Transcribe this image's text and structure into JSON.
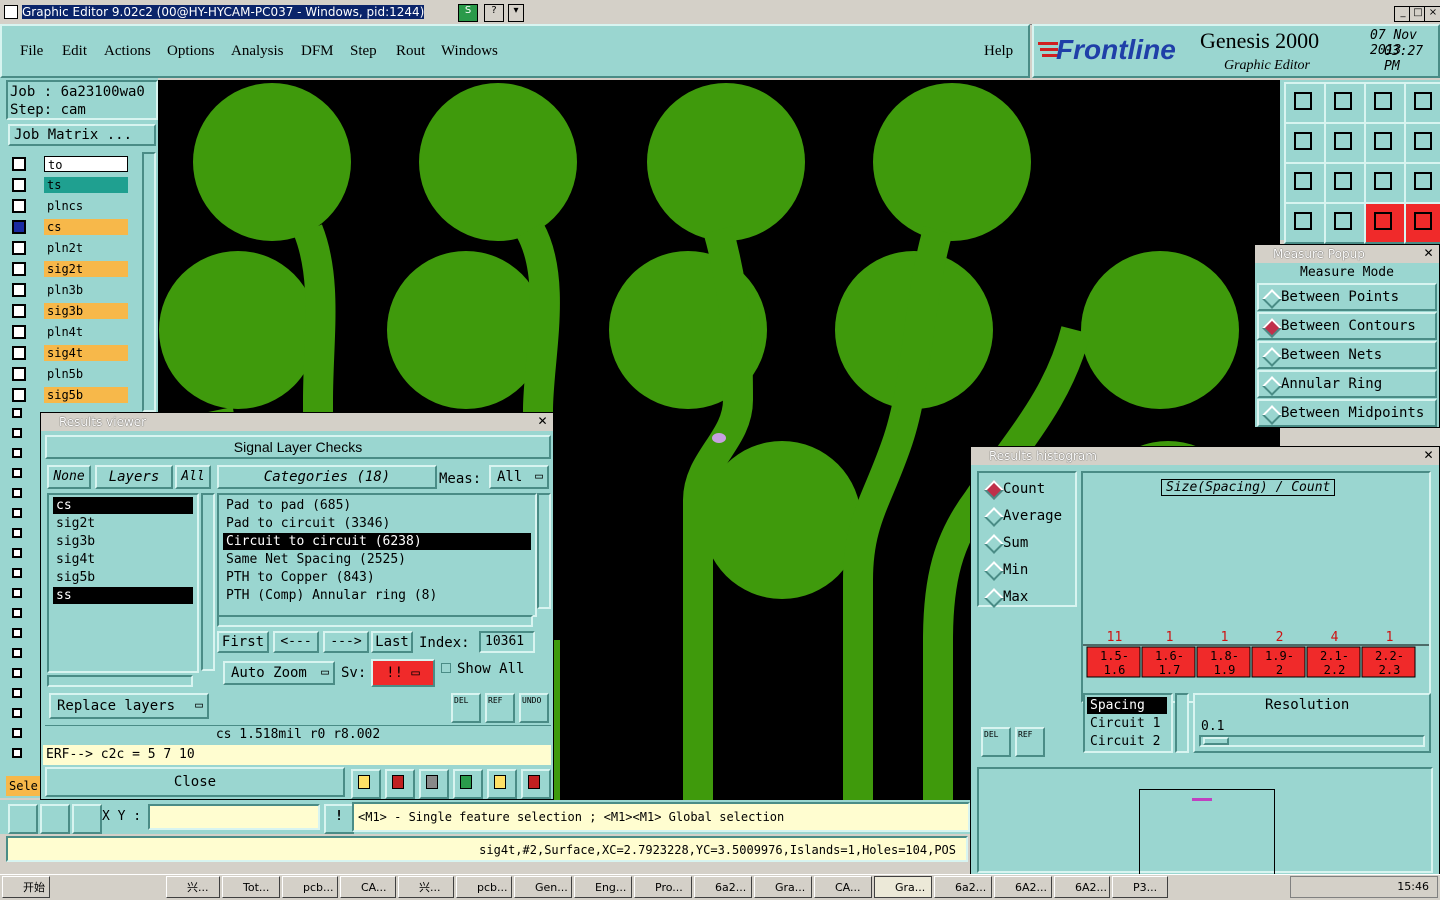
{
  "window": {
    "title": "Graphic Editor 9.02c2 (00@HY-HYCAM-PC037 - Windows, pid:1244)"
  },
  "menu": {
    "items": [
      "File",
      "Edit",
      "Actions",
      "Options",
      "Analysis",
      "DFM",
      "Step",
      "Rout",
      "Windows"
    ],
    "help": "Help"
  },
  "brand": {
    "logo": "Frontline",
    "product": "Genesis 2000",
    "subtitle": "Graphic Editor",
    "date": "07 Nov 2013",
    "time": "03:27 PM"
  },
  "job": {
    "job_line": "Job : 6a23100wa0",
    "step_line": "Step: cam",
    "matrix_button": "Job Matrix ..."
  },
  "layers": [
    {
      "name": "to",
      "color": "#ffffff",
      "active": false
    },
    {
      "name": "ts",
      "color": "#1fa090",
      "active": false
    },
    {
      "name": "plncs",
      "color": "#9ad6d0",
      "active": false
    },
    {
      "name": "cs",
      "color": "#f7b84a",
      "active": true
    },
    {
      "name": "pln2t",
      "color": "#9ad6d0",
      "active": false
    },
    {
      "name": "sig2t",
      "color": "#f7b84a",
      "active": false
    },
    {
      "name": "pln3b",
      "color": "#9ad6d0",
      "active": false
    },
    {
      "name": "sig3b",
      "color": "#f7b84a",
      "active": false
    },
    {
      "name": "pln4t",
      "color": "#9ad6d0",
      "active": false
    },
    {
      "name": "sig4t",
      "color": "#f7b84a",
      "active": false
    },
    {
      "name": "pln5b",
      "color": "#9ad6d0",
      "active": false
    },
    {
      "name": "sig5b",
      "color": "#f7b84a",
      "active": false
    }
  ],
  "sele_label": "Sele",
  "results_viewer": {
    "title": "Results viewer",
    "header": "Signal Layer Checks",
    "none_btn": "None",
    "layers_btn": "Layers",
    "all_btn": "All",
    "categories_btn": "Categories (18)",
    "meas_label": "Meas:",
    "meas_value": "All",
    "layer_list": [
      "cs",
      "sig2t",
      "sig3b",
      "sig4t",
      "sig5b",
      "ss"
    ],
    "categories": [
      "Pad to pad (685)",
      "Pad to circuit (3346)",
      "Circuit to circuit (6238)",
      "Same Net Spacing (2525)",
      "PTH to Copper (843)",
      "PTH (Comp) Annular ring (8)"
    ],
    "nav": {
      "first": "First",
      "prev": "<---",
      "next": "--->",
      "last": "Last",
      "index_label": "Index:",
      "index_value": "10361"
    },
    "auto_zoom": "Auto Zoom",
    "sv_label": "Sv:",
    "sv_value": "!!",
    "show_all": "Show All",
    "replace_layers": "Replace layers",
    "small_btns": [
      "DEL",
      "REF",
      "UNDO"
    ],
    "status": "cs 1.518mil   r0   r8.002",
    "erf": "ERF--> c2c = 5 7 10",
    "close": "Close"
  },
  "measure_popup": {
    "title": "Measure Popup",
    "header": "Measure Mode",
    "options": [
      {
        "label": "Between Points",
        "selected": false
      },
      {
        "label": "Between Contours",
        "selected": true
      },
      {
        "label": "Between Nets",
        "selected": false
      },
      {
        "label": "Annular Ring",
        "selected": false
      },
      {
        "label": "Between Midpoints",
        "selected": false
      }
    ]
  },
  "histogram": {
    "title": "Results histogram",
    "modes": [
      {
        "label": "Count",
        "selected": true
      },
      {
        "label": "Average",
        "selected": false
      },
      {
        "label": "Sum",
        "selected": false
      },
      {
        "label": "Min",
        "selected": false
      },
      {
        "label": "Max",
        "selected": false
      }
    ],
    "chart_title": "Size(Spacing) / Count",
    "bins": [
      {
        "count": "11",
        "top": "1.5-",
        "bottom": "1.6"
      },
      {
        "count": "1",
        "top": "1.6-",
        "bottom": "1.7"
      },
      {
        "count": "1",
        "top": "1.8-",
        "bottom": "1.9"
      },
      {
        "count": "2",
        "top": "1.9-",
        "bottom": "2"
      },
      {
        "count": "4",
        "top": "2.1-",
        "bottom": "2.2"
      },
      {
        "count": "1",
        "top": "2.2-",
        "bottom": "2.3"
      }
    ],
    "list": [
      "Spacing",
      "Circuit 1",
      "Circuit 2"
    ],
    "resolution_label": "Resolution",
    "resolution_value": "0.1",
    "small_btns": [
      "DEL",
      "REF"
    ]
  },
  "bottom": {
    "xy_label": "X Y :",
    "xy_value": "",
    "hint": "<M1> - Single feature selection ; <M1><M1> Global selection",
    "feature_info": "sig4t,#2,Surface,XC=2.7923228,YC=3.5009976,Islands=1,Holes=104,POS"
  },
  "taskbar": {
    "start": "开始",
    "tasks": [
      "兴...",
      "Tot...",
      "pcb...",
      "CA...",
      "兴...",
      "pcb...",
      "Gen...",
      "Eng...",
      "Pro...",
      "6a2...",
      "Gra...",
      "CA...",
      "Gra...",
      "6a2...",
      "6A2...",
      "6A2...",
      "P3..."
    ],
    "clock": "15:46"
  },
  "colors": {
    "ui_teal": "#9ad6d0",
    "copper": "#3f9a0c",
    "highlight_red": "#f02a2a",
    "layer_orange": "#f7b84a"
  }
}
